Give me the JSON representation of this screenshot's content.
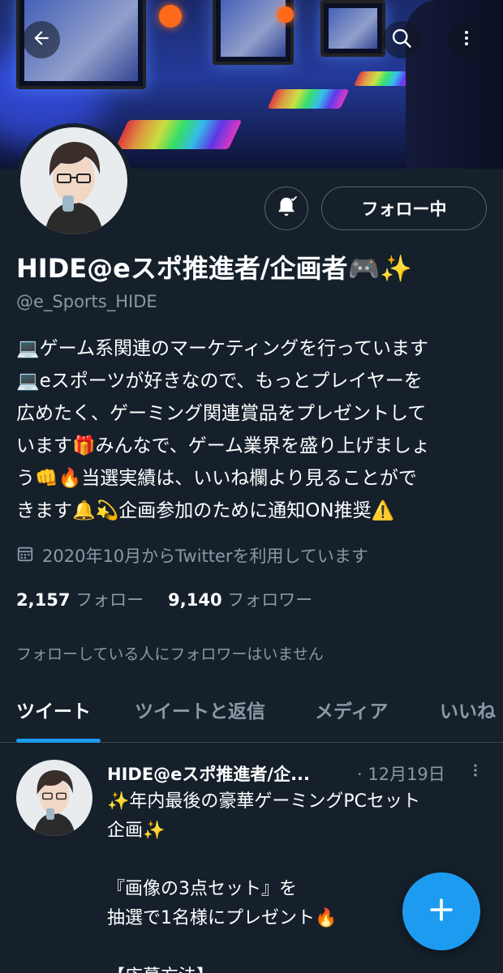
{
  "header": {
    "back_icon": "arrow-left-icon",
    "search_icon": "search-icon",
    "more_icon": "more-vertical-icon"
  },
  "profile": {
    "display_name": "HIDE@eスポ推進者/企画者🎮✨",
    "handle": "@e_Sports_HIDE",
    "follow_button_label": "フォロー中",
    "bio_lines": [
      "💻ゲーム系関連のマーケティングを行っています",
      "💻eスポーツが好きなので、もっとプレイヤーを",
      "広めたく、ゲーミング関連賞品をプレゼントして",
      "います🎁みんなで、ゲーム業界を盛り上げましょ",
      "う👊🔥当選実績は、いいね欄より見ることがで",
      "きます🔔💫企画参加のために通知ON推奨⚠️"
    ],
    "joined": "2020年10月からTwitterを利用しています",
    "following_count": "2,157",
    "following_label": "フォロー",
    "followers_count": "9,140",
    "followers_label": "フォロワー",
    "mutuals_note": "フォローしている人にフォロワーはいません"
  },
  "tabs": [
    {
      "label": "ツイート",
      "active": true
    },
    {
      "label": "ツイートと返信",
      "active": false
    },
    {
      "label": "メディア",
      "active": false
    },
    {
      "label": "いいね",
      "active": false
    }
  ],
  "tweet": {
    "author": "HIDE@eスポ推進者/企...",
    "date": "· 12月19日",
    "lines": [
      "✨年内最後の豪華ゲーミングPCセット",
      "企画✨",
      "",
      "『画像の3点セット』を",
      "抽選で1名様にプレゼント🔥",
      "",
      "【応募方法】"
    ]
  },
  "colors": {
    "background": "#15202b",
    "accent": "#1d9bf0",
    "secondary_text": "#8b98a5"
  }
}
